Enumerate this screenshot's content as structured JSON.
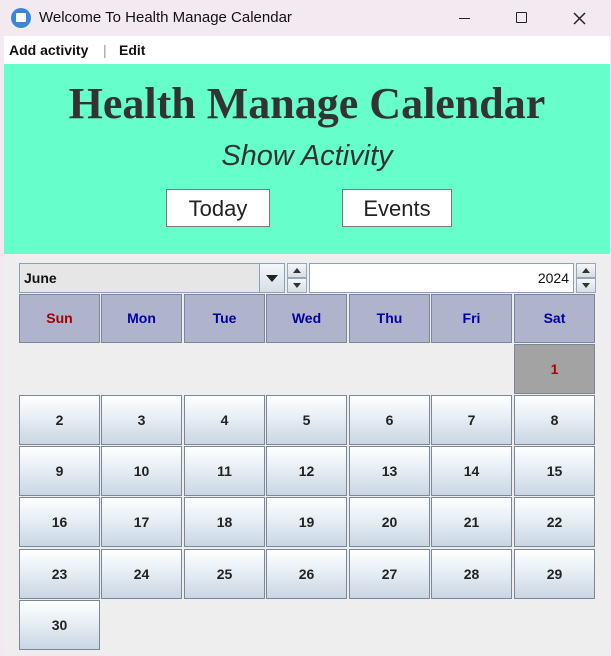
{
  "window": {
    "title": "Welcome To Health Manage Calendar"
  },
  "menu": {
    "items": [
      "Add activity",
      "Edit"
    ],
    "separator": "|"
  },
  "header": {
    "title": "Health Manage Calendar",
    "subtitle": "Show Activity",
    "buttons": {
      "today": "Today",
      "events": "Events"
    },
    "background": "#66ffcc"
  },
  "calendar": {
    "month": "June",
    "year": "2024",
    "weekdays": [
      "Sun",
      "Mon",
      "Tue",
      "Wed",
      "Thu",
      "Fri",
      "Sat"
    ],
    "first_weekday_index": 6,
    "days_in_month": 30,
    "selected_day": 1,
    "colors": {
      "weekday_text": "#0000a8",
      "sunday_text": "#a00000",
      "selected_text": "#b00000",
      "selected_bg": "#a3a3a3"
    }
  }
}
